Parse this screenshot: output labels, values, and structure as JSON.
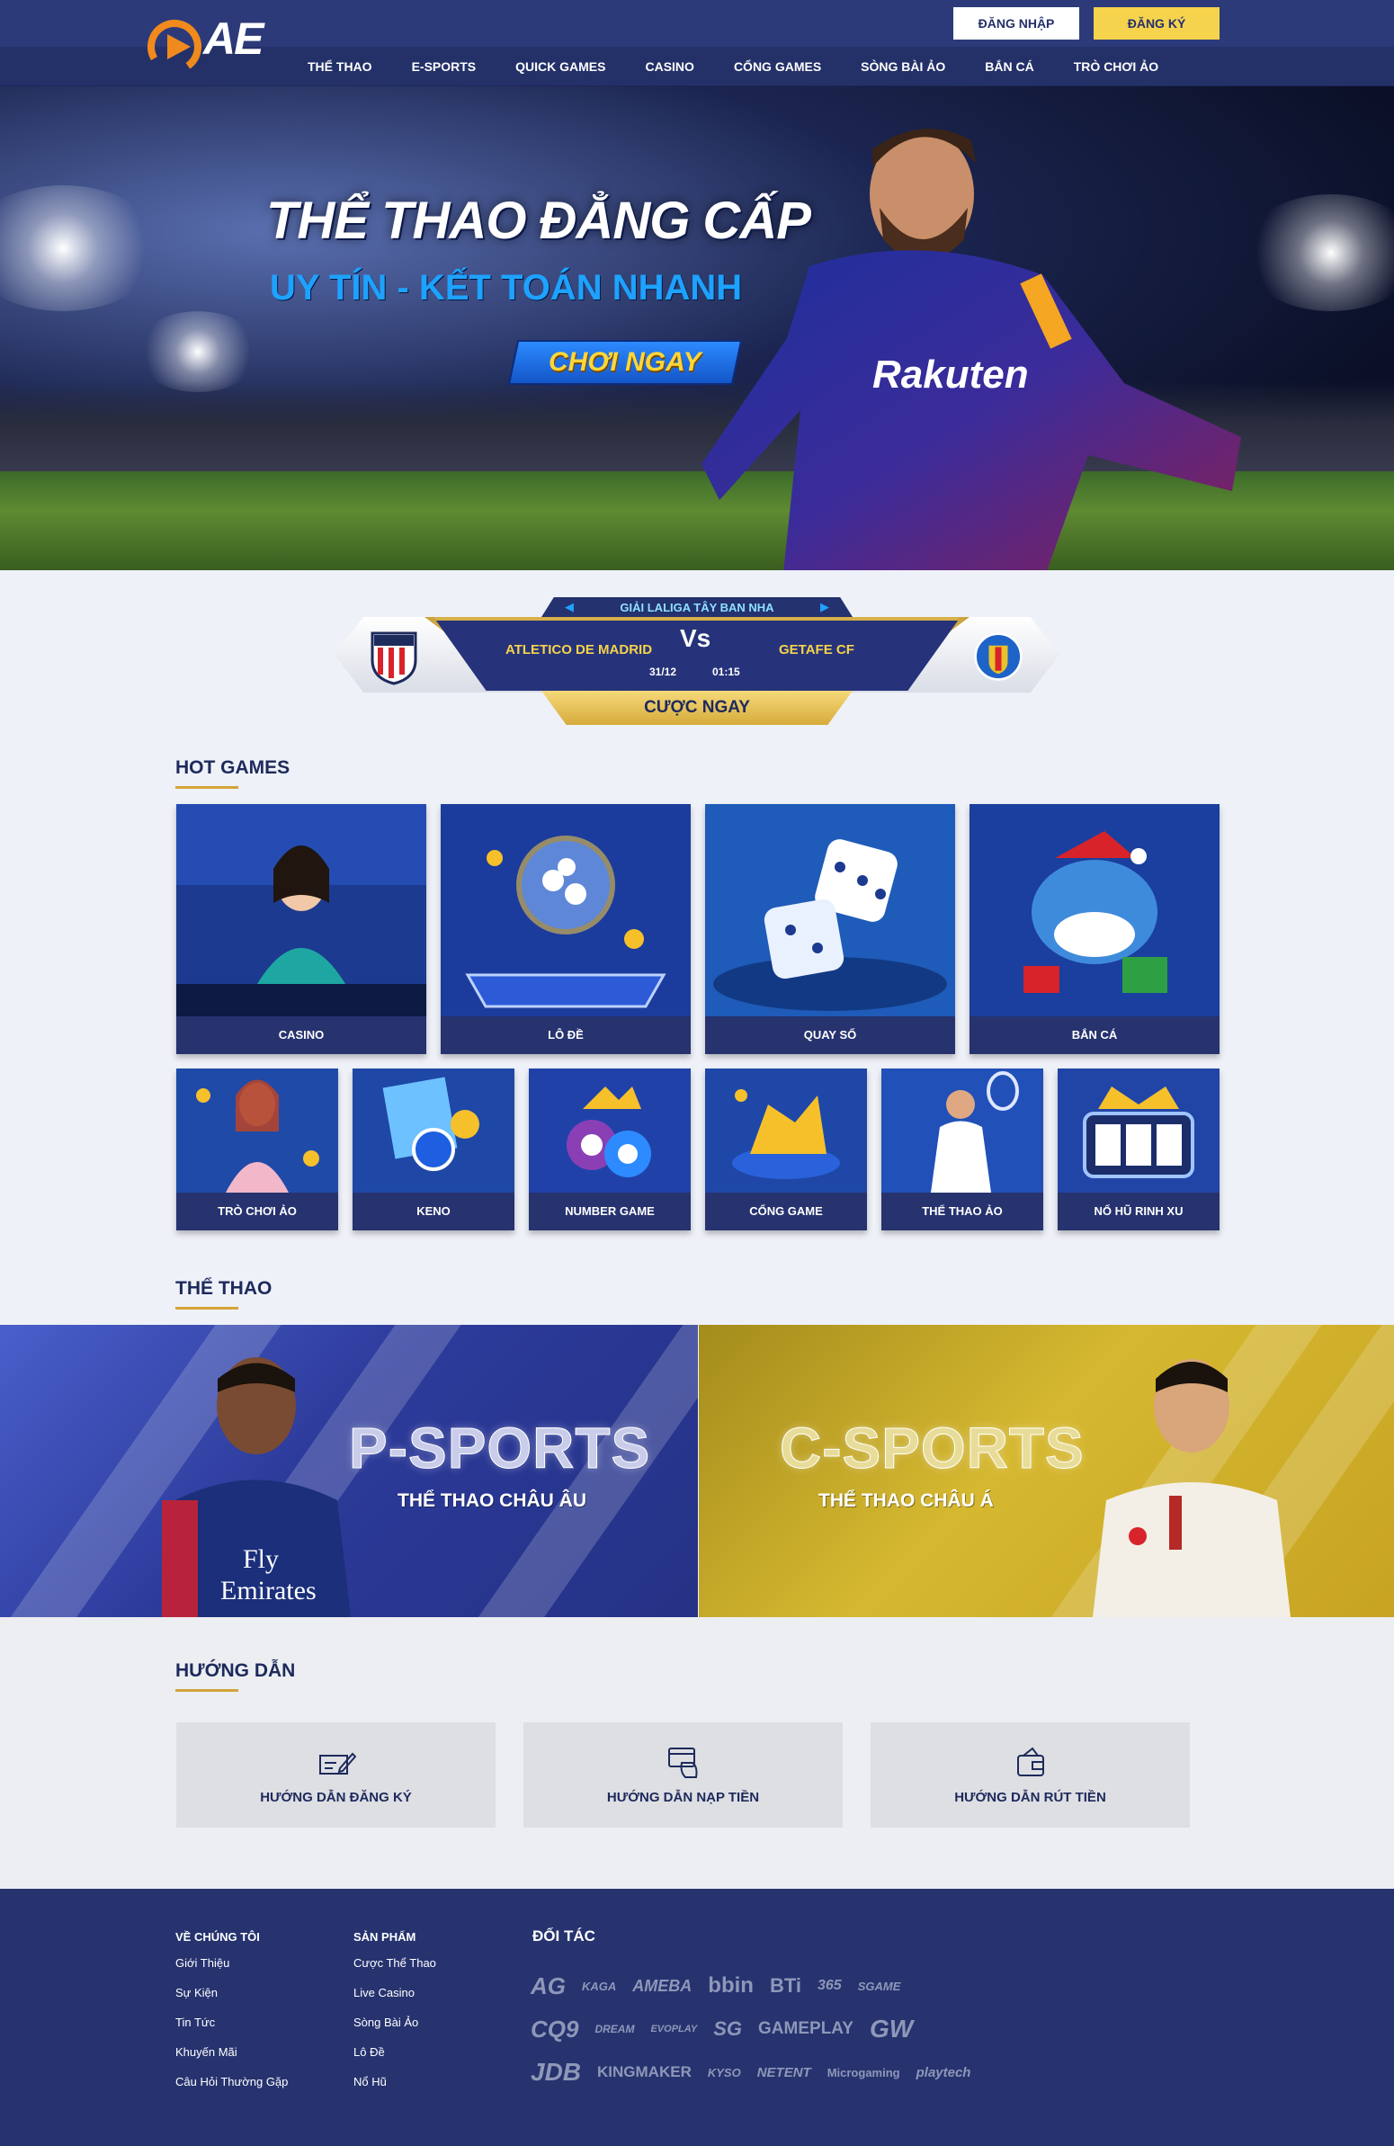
{
  "header": {
    "logo_text": "AE",
    "login_label": "ĐĂNG NHẬP",
    "register_label": "ĐĂNG KÝ",
    "nav": [
      "THỂ THAO",
      "E-SPORTS",
      "QUICK GAMES",
      "CASINO",
      "CỔNG GAMES",
      "SÒNG BÀI ẢO",
      "BẮN CÁ",
      "TRÒ CHƠI ẢO"
    ]
  },
  "hero": {
    "title": "THỂ THAO ĐẲNG CẤP",
    "subtitle": "UY TÍN  - KẾT TOÁN NHANH",
    "cta": "CHƠI NGAY"
  },
  "match": {
    "league": "GIẢI LALIGA TÂY BAN NHA",
    "home": "ATLETICO DE MADRID",
    "away": "GETAFE CF",
    "vs": "Vs",
    "date": "31/12",
    "time": "01:15",
    "bet_label": "CƯỢC NGAY"
  },
  "hot_games": {
    "title": "HOT GAMES",
    "big": [
      "CASINO",
      "LÔ ĐỀ",
      "QUAY SỐ",
      "BẮN CÁ"
    ],
    "small": [
      "TRÒ CHƠI ẢO",
      "KENO",
      "NUMBER GAME",
      "CỔNG GAME",
      "THỂ THAO ẢO",
      "NỔ HŨ RINH XU"
    ]
  },
  "sports": {
    "title": "THỂ THAO",
    "p_name": "P-SPORTS",
    "p_sub": "THỂ THAO CHÂU ÂU",
    "c_name": "C-SPORTS",
    "c_sub": "THỂ THAO CHÂU Á"
  },
  "guide": {
    "title": "HƯỚNG DẪN",
    "items": [
      "HƯỚNG DẪN ĐĂNG KÝ",
      "HƯỚNG DẪN NẠP TIỀN",
      "HƯỚNG DẪN RÚT TIỀN"
    ]
  },
  "footer": {
    "about": {
      "head": "VỀ CHÚNG TÔI",
      "links": [
        "Giới Thiệu",
        "Sự Kiện",
        "Tin Tức",
        "Khuyến Mãi",
        "Câu Hỏi Thường Gặp"
      ]
    },
    "products": {
      "head": "SẢN PHẨM",
      "links": [
        "Cược Thể Thao",
        "Live Casino",
        "Sòng Bài Ảo",
        "Lô Đề",
        "Nổ Hũ"
      ]
    },
    "partners_head": "ĐỐI TÁC",
    "partners": [
      [
        "AG",
        "KAGA",
        "AMEBA",
        "bbin",
        "BTi",
        "365",
        "SGAME"
      ],
      [
        "CQ9",
        "DREAM",
        "EVOPLAY",
        "SG",
        "GAMEPLAY",
        "GW"
      ],
      [
        "JDB",
        "KINGMAKER",
        "KYSO",
        "NETENT",
        "Microgaming",
        "playtech"
      ]
    ]
  },
  "colors": {
    "navy": "#26336f",
    "gold": "#f6d34d",
    "accent_blue": "#1ea2ff"
  }
}
